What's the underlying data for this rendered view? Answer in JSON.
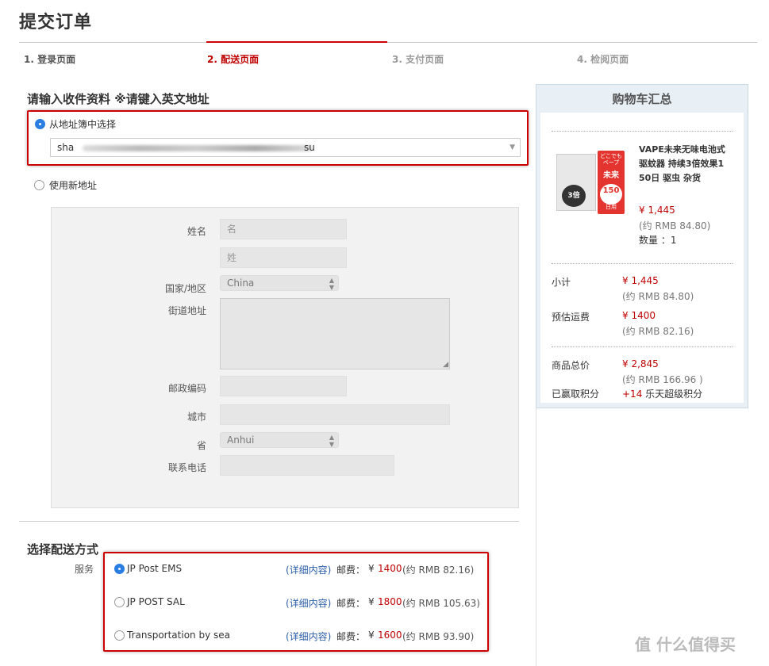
{
  "page_title": "提交订单",
  "steps": [
    "1. 登录页面",
    "2. 配送页面",
    "3. 支付页面",
    "4. 检阅页面"
  ],
  "address": {
    "heading": "请输入收件资料 ※请键入英文地址",
    "from_book_label": "从地址簿中选择",
    "selected_address_start": "sha",
    "selected_address_end": "su",
    "new_address_label": "使用新地址"
  },
  "form": {
    "name_label": "姓名",
    "first_name_placeholder": "名",
    "last_name_placeholder": "姓",
    "country_label": "国家/地区",
    "country_value": "China",
    "street_label": "街道地址",
    "postal_label": "邮政编码",
    "city_label": "城市",
    "province_label": "省",
    "province_value": "Anhui",
    "phone_label": "联系电话"
  },
  "shipping": {
    "heading": "选择配送方式",
    "service_label": "服务",
    "options": [
      {
        "name": "JP Post EMS",
        "details": "(详细内容)",
        "fee_label": "邮费：",
        "yen_sign": "¥",
        "fee": "1400",
        "rmb": "(约 RMB 82.16)",
        "selected": true
      },
      {
        "name": "JP POST SAL",
        "details": "(详细内容)",
        "fee_label": "邮费：",
        "yen_sign": "¥",
        "fee": "1800",
        "rmb": "(约 RMB 105.63)",
        "selected": false
      },
      {
        "name": "Transportation by sea",
        "details": "(详细内容)",
        "fee_label": "邮费：",
        "yen_sign": "¥",
        "fee": "1600",
        "rmb": "(约 RMB 93.90)",
        "selected": false
      }
    ]
  },
  "cart": {
    "title": "购物车汇总",
    "product": {
      "name_lines": [
        "VAPE未来无味电池式",
        "驱蚊器 持续3倍效果1",
        "50日 驱虫 杂货"
      ],
      "price": "¥ 1,445",
      "rmb": "(约 RMB 84.80)",
      "qty": "数量 ：1",
      "img_text_top": "どこでも\nベープ",
      "img_text_mirai": "未来",
      "img_text_3x": "3倍",
      "img_text_150": "150",
      "img_text_days": "日用"
    },
    "subtotal_label": "小计",
    "subtotal": "¥ 1,445",
    "subtotal_rmb": "(约 RMB 84.80)",
    "shipping_label": "预估运费",
    "shipping": "¥ 1400",
    "shipping_rmb": "(约 RMB 82.16)",
    "total_label": "商品总价",
    "total": "¥ 2,845",
    "total_rmb": "(约 RMB 166.96 )",
    "points_label": "已赢取积分",
    "points_value": "+14",
    "points_suffix": " 乐天超级积分"
  },
  "watermark": "值 什么值得买"
}
